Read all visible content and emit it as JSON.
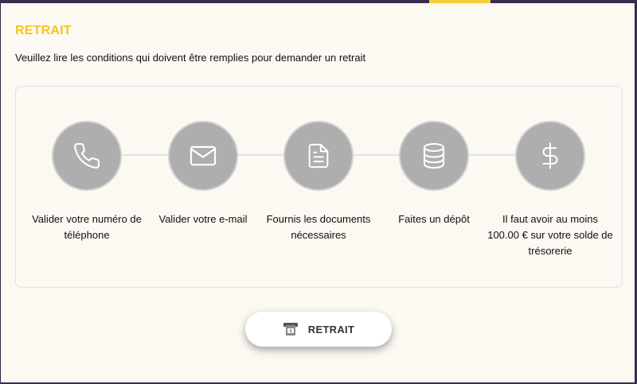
{
  "header": {
    "title": "RETRAIT",
    "subtitle": "Veuillez lire les conditions qui doivent être remplies pour demander un retrait",
    "accent_color": "#f5c518"
  },
  "steps": [
    {
      "icon": "phone-icon",
      "label": "Valider votre numéro de téléphone"
    },
    {
      "icon": "mail-icon",
      "label": "Valider votre e-mail"
    },
    {
      "icon": "document-icon",
      "label": "Fournis les documents nécessaires"
    },
    {
      "icon": "database-icon",
      "label": "Faites un dépôt"
    },
    {
      "icon": "dollar-icon",
      "label": "Il faut avoir au moins 100.00 € sur votre solde de trésorerie"
    }
  ],
  "withdraw_button": {
    "label": "RETRAIT",
    "icon": "atm-withdraw-icon"
  },
  "colors": {
    "background": "#fcf8f2",
    "circle": "#aeaeae",
    "top_bar": "#3a2d52",
    "tab_indicator": "#f3cf3e"
  }
}
